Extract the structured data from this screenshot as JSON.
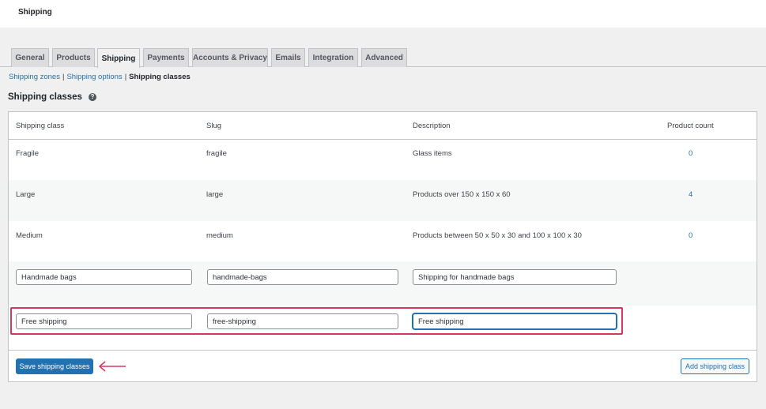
{
  "page": {
    "title": "Shipping"
  },
  "tabs": [
    {
      "label": "General"
    },
    {
      "label": "Products"
    },
    {
      "label": "Shipping"
    },
    {
      "label": "Payments"
    },
    {
      "label": "Accounts & Privacy"
    },
    {
      "label": "Emails"
    },
    {
      "label": "Integration"
    },
    {
      "label": "Advanced"
    }
  ],
  "subnav": {
    "zones": "Shipping zones",
    "options": "Shipping options",
    "classes": "Shipping classes",
    "separator": "|"
  },
  "section": {
    "title": "Shipping classes",
    "help_icon": "?"
  },
  "table": {
    "headers": {
      "class": "Shipping class",
      "slug": "Slug",
      "description": "Description",
      "count": "Product count"
    },
    "rows": [
      {
        "class": "Fragile",
        "slug": "fragile",
        "description": "Glass items",
        "count": "0"
      },
      {
        "class": "Large",
        "slug": "large",
        "description": "Products over 150 x 150 x 60",
        "count": "4"
      },
      {
        "class": "Medium",
        "slug": "medium",
        "description": "Products between 50 x 50 x 30 and 100 x 100 x 30",
        "count": "0"
      }
    ],
    "edit_rows": [
      {
        "class": "Handmade bags",
        "slug": "handmade-bags",
        "description": "Shipping for handmade bags"
      },
      {
        "class": "Free shipping",
        "slug": "free-shipping",
        "description": "Free shipping"
      }
    ]
  },
  "footer": {
    "save_label": "Save shipping classes",
    "add_label": "Add shipping class"
  },
  "colors": {
    "accent": "#2271b1",
    "highlight": "#d63660"
  },
  "icons": {
    "help": "help-icon",
    "arrow": "arrow-left-icon"
  }
}
